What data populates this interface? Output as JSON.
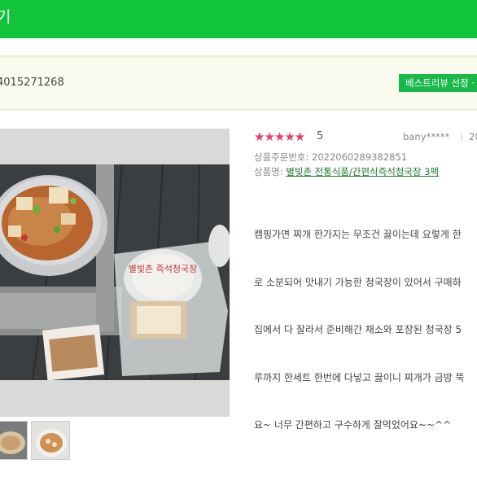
{
  "header": {
    "title": "기"
  },
  "order_bar": {
    "order_number": "4015271268",
    "best_badge": "베스트리뷰 선정 ·"
  },
  "review": {
    "rating_stars": "★★★★★",
    "rating_value": "5",
    "user": "bany*****",
    "separator": "|",
    "date": "20",
    "order_no_label": "상품주문번호:",
    "order_no": "2022060289382851",
    "product_label": "상품명:",
    "product_name": "별빛촌 전통식품/간편식즉석청국장 3팩",
    "body_lines": [
      "캠핑가면 찌개 한가지는 무조건 끓이는데 요렇게 한",
      "로 소분되어 맛내기 가능한 청국장이 있어서 구매하",
      "집에서 다 잘라서 준비해간 채소와 포장된 청국장 5",
      "루까지 한세트 한번에 다넣고 끓이니 찌개가 금방 뚝",
      "요~ 너무 간편하고 구수하게 잘먹었어요~~^^"
    ]
  },
  "photo": {
    "package_label": "별빛촌 즉석청국장"
  },
  "colors": {
    "brand_green": "#12c43a",
    "star_red": "#ee3b5c",
    "badge_green": "#19b84a"
  }
}
